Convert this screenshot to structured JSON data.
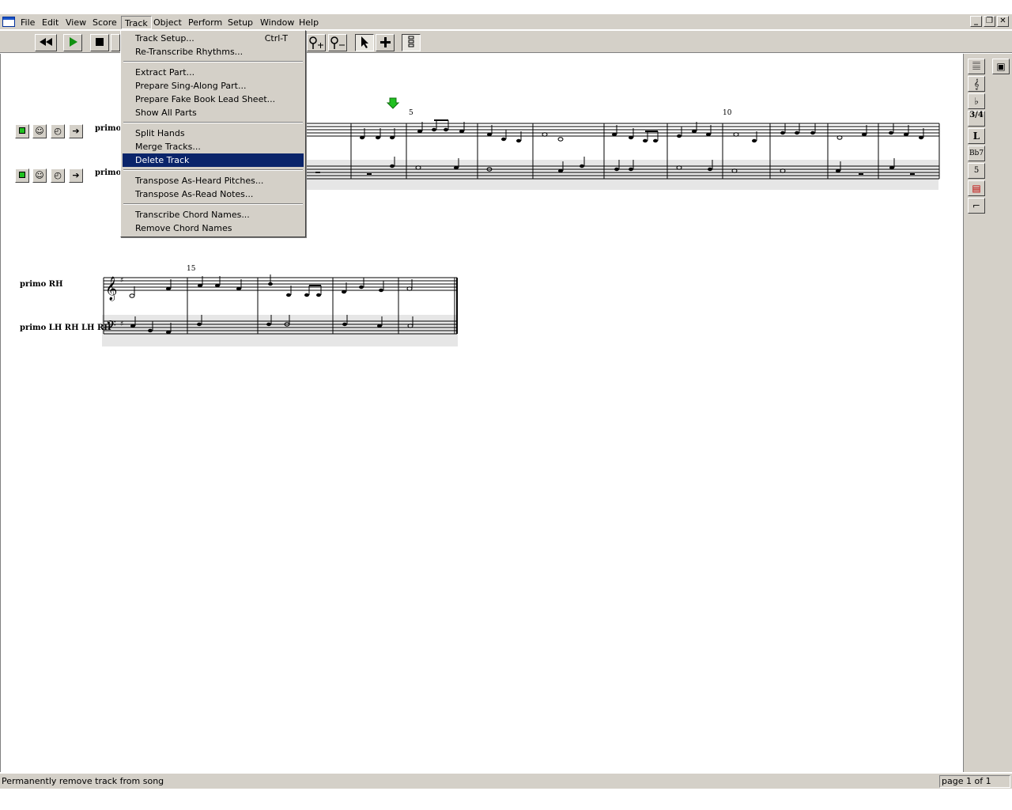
{
  "menubar": {
    "items": [
      "File",
      "Edit",
      "View",
      "Score",
      "Track",
      "Object",
      "Perform",
      "Setup",
      "Window",
      "Help"
    ],
    "open_menu": "Track"
  },
  "window_controls": {
    "minimize": "_",
    "restore": "❐",
    "close": "✕"
  },
  "track_menu": {
    "items": [
      {
        "label": "Track Setup...",
        "shortcut": "Ctrl-T"
      },
      {
        "label": "Re-Transcribe Rhythms..."
      },
      {
        "label": "Extract Part..."
      },
      {
        "label": "Prepare Sing-Along Part..."
      },
      {
        "label": "Prepare Fake Book Lead Sheet..."
      },
      {
        "label": "Show All Parts"
      },
      {
        "label": "Split Hands"
      },
      {
        "label": "Merge Tracks..."
      },
      {
        "label": "Delete Track",
        "highlighted": true
      },
      {
        "label": "Transpose As-Heard Pitches..."
      },
      {
        "label": "Transpose As-Read Notes..."
      },
      {
        "label": "Transcribe Chord Names..."
      },
      {
        "label": "Remove Chord Names"
      }
    ]
  },
  "toolbar": {
    "rewind_icon": "rewind-icon",
    "play_icon": "play-icon",
    "stop_icon": "stop-icon",
    "add_note_icon": "note-plus-icon",
    "remove_note_icon": "note-minus-icon",
    "select_icon": "arrow-pointer-icon",
    "crosshair_icon": "plus-icon",
    "view_icon": "staff-view-icon"
  },
  "score": {
    "system1": {
      "labels": [
        "primo l",
        "primo l"
      ],
      "measure_numbers": [
        "5",
        "10"
      ]
    },
    "system2": {
      "labels": [
        "primo RH",
        "primo LH RH LH RH"
      ],
      "measure_numbers": [
        "15"
      ]
    }
  },
  "right_palette": [
    "staff-icon",
    "treble-clef-icon",
    "key-signature-icon",
    "time-signature-icon",
    "lyric-icon",
    "chord-symbol-icon",
    "fingering-icon",
    "tempo-icon",
    "ending-icon"
  ],
  "right_palette_labels": {
    "time": "3/4",
    "lyric": "L",
    "chord": "Bb7",
    "finger": "5"
  },
  "status": {
    "message": "Permanently remove track from song",
    "page": "page 1 of 1"
  },
  "colors": {
    "menu_bg": "#d4d0c8",
    "highlight": "#0a246a",
    "play_green": "#109010",
    "marker_green": "#20c020"
  }
}
